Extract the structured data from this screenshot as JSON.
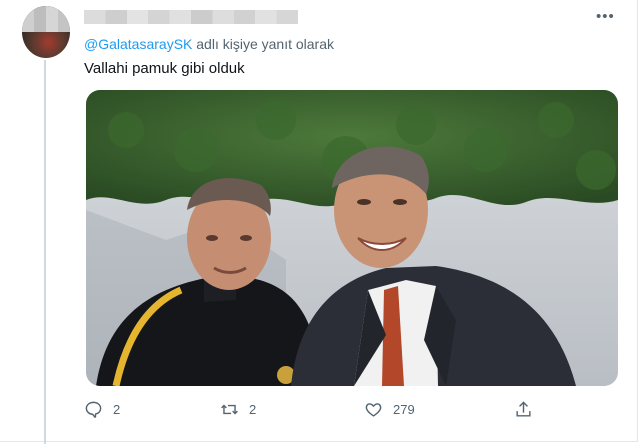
{
  "tweet": {
    "reply_prefix": "",
    "reply_handle": "@GalatasaraySK",
    "reply_suffix": " adlı kişiye yanıt olarak",
    "text": "Vallahi pamuk gibi olduk",
    "more_label": "•••"
  },
  "actions": {
    "reply_count": "2",
    "retweet_count": "2",
    "like_count": "279"
  },
  "icons": {
    "reply": "reply-icon",
    "retweet": "retweet-icon",
    "like": "heart-icon",
    "share": "share-icon",
    "more": "more-icon"
  },
  "colors": {
    "accent": "#1d9bf0",
    "secondary_text": "#536471",
    "primary_text": "#0f1419"
  }
}
